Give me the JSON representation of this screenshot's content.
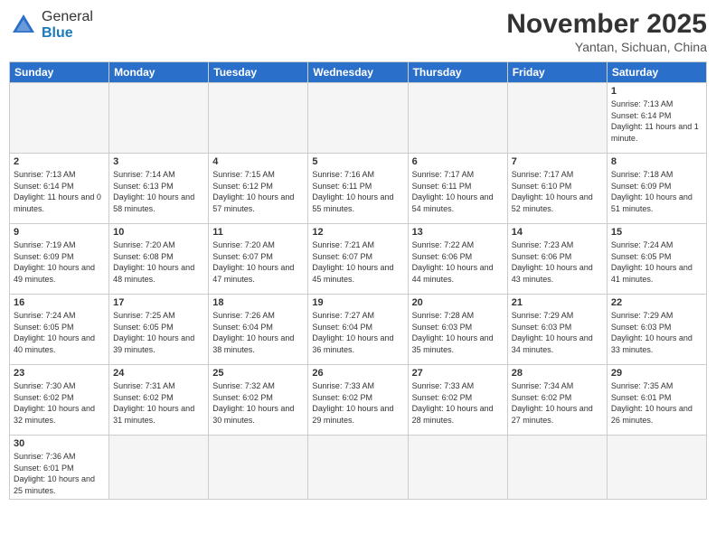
{
  "header": {
    "logo_general": "General",
    "logo_blue": "Blue",
    "month_title": "November 2025",
    "location": "Yantan, Sichuan, China"
  },
  "days_of_week": [
    "Sunday",
    "Monday",
    "Tuesday",
    "Wednesday",
    "Thursday",
    "Friday",
    "Saturday"
  ],
  "weeks": [
    [
      {
        "day": "",
        "empty": true
      },
      {
        "day": "",
        "empty": true
      },
      {
        "day": "",
        "empty": true
      },
      {
        "day": "",
        "empty": true
      },
      {
        "day": "",
        "empty": true
      },
      {
        "day": "",
        "empty": true
      },
      {
        "day": "1",
        "sunrise": "Sunrise: 7:13 AM",
        "sunset": "Sunset: 6:14 PM",
        "daylight": "Daylight: 11 hours and 1 minute."
      }
    ],
    [
      {
        "day": "2",
        "sunrise": "Sunrise: 7:13 AM",
        "sunset": "Sunset: 6:14 PM",
        "daylight": "Daylight: 11 hours and 0 minutes."
      },
      {
        "day": "3",
        "sunrise": "Sunrise: 7:14 AM",
        "sunset": "Sunset: 6:13 PM",
        "daylight": "Daylight: 10 hours and 58 minutes."
      },
      {
        "day": "4",
        "sunrise": "Sunrise: 7:15 AM",
        "sunset": "Sunset: 6:12 PM",
        "daylight": "Daylight: 10 hours and 57 minutes."
      },
      {
        "day": "5",
        "sunrise": "Sunrise: 7:16 AM",
        "sunset": "Sunset: 6:11 PM",
        "daylight": "Daylight: 10 hours and 55 minutes."
      },
      {
        "day": "6",
        "sunrise": "Sunrise: 7:17 AM",
        "sunset": "Sunset: 6:11 PM",
        "daylight": "Daylight: 10 hours and 54 minutes."
      },
      {
        "day": "7",
        "sunrise": "Sunrise: 7:17 AM",
        "sunset": "Sunset: 6:10 PM",
        "daylight": "Daylight: 10 hours and 52 minutes."
      },
      {
        "day": "8",
        "sunrise": "Sunrise: 7:18 AM",
        "sunset": "Sunset: 6:09 PM",
        "daylight": "Daylight: 10 hours and 51 minutes."
      }
    ],
    [
      {
        "day": "9",
        "sunrise": "Sunrise: 7:19 AM",
        "sunset": "Sunset: 6:09 PM",
        "daylight": "Daylight: 10 hours and 49 minutes."
      },
      {
        "day": "10",
        "sunrise": "Sunrise: 7:20 AM",
        "sunset": "Sunset: 6:08 PM",
        "daylight": "Daylight: 10 hours and 48 minutes."
      },
      {
        "day": "11",
        "sunrise": "Sunrise: 7:20 AM",
        "sunset": "Sunset: 6:07 PM",
        "daylight": "Daylight: 10 hours and 47 minutes."
      },
      {
        "day": "12",
        "sunrise": "Sunrise: 7:21 AM",
        "sunset": "Sunset: 6:07 PM",
        "daylight": "Daylight: 10 hours and 45 minutes."
      },
      {
        "day": "13",
        "sunrise": "Sunrise: 7:22 AM",
        "sunset": "Sunset: 6:06 PM",
        "daylight": "Daylight: 10 hours and 44 minutes."
      },
      {
        "day": "14",
        "sunrise": "Sunrise: 7:23 AM",
        "sunset": "Sunset: 6:06 PM",
        "daylight": "Daylight: 10 hours and 43 minutes."
      },
      {
        "day": "15",
        "sunrise": "Sunrise: 7:24 AM",
        "sunset": "Sunset: 6:05 PM",
        "daylight": "Daylight: 10 hours and 41 minutes."
      }
    ],
    [
      {
        "day": "16",
        "sunrise": "Sunrise: 7:24 AM",
        "sunset": "Sunset: 6:05 PM",
        "daylight": "Daylight: 10 hours and 40 minutes."
      },
      {
        "day": "17",
        "sunrise": "Sunrise: 7:25 AM",
        "sunset": "Sunset: 6:05 PM",
        "daylight": "Daylight: 10 hours and 39 minutes."
      },
      {
        "day": "18",
        "sunrise": "Sunrise: 7:26 AM",
        "sunset": "Sunset: 6:04 PM",
        "daylight": "Daylight: 10 hours and 38 minutes."
      },
      {
        "day": "19",
        "sunrise": "Sunrise: 7:27 AM",
        "sunset": "Sunset: 6:04 PM",
        "daylight": "Daylight: 10 hours and 36 minutes."
      },
      {
        "day": "20",
        "sunrise": "Sunrise: 7:28 AM",
        "sunset": "Sunset: 6:03 PM",
        "daylight": "Daylight: 10 hours and 35 minutes."
      },
      {
        "day": "21",
        "sunrise": "Sunrise: 7:29 AM",
        "sunset": "Sunset: 6:03 PM",
        "daylight": "Daylight: 10 hours and 34 minutes."
      },
      {
        "day": "22",
        "sunrise": "Sunrise: 7:29 AM",
        "sunset": "Sunset: 6:03 PM",
        "daylight": "Daylight: 10 hours and 33 minutes."
      }
    ],
    [
      {
        "day": "23",
        "sunrise": "Sunrise: 7:30 AM",
        "sunset": "Sunset: 6:02 PM",
        "daylight": "Daylight: 10 hours and 32 minutes."
      },
      {
        "day": "24",
        "sunrise": "Sunrise: 7:31 AM",
        "sunset": "Sunset: 6:02 PM",
        "daylight": "Daylight: 10 hours and 31 minutes."
      },
      {
        "day": "25",
        "sunrise": "Sunrise: 7:32 AM",
        "sunset": "Sunset: 6:02 PM",
        "daylight": "Daylight: 10 hours and 30 minutes."
      },
      {
        "day": "26",
        "sunrise": "Sunrise: 7:33 AM",
        "sunset": "Sunset: 6:02 PM",
        "daylight": "Daylight: 10 hours and 29 minutes."
      },
      {
        "day": "27",
        "sunrise": "Sunrise: 7:33 AM",
        "sunset": "Sunset: 6:02 PM",
        "daylight": "Daylight: 10 hours and 28 minutes."
      },
      {
        "day": "28",
        "sunrise": "Sunrise: 7:34 AM",
        "sunset": "Sunset: 6:02 PM",
        "daylight": "Daylight: 10 hours and 27 minutes."
      },
      {
        "day": "29",
        "sunrise": "Sunrise: 7:35 AM",
        "sunset": "Sunset: 6:01 PM",
        "daylight": "Daylight: 10 hours and 26 minutes."
      }
    ],
    [
      {
        "day": "30",
        "sunrise": "Sunrise: 7:36 AM",
        "sunset": "Sunset: 6:01 PM",
        "daylight": "Daylight: 10 hours and 25 minutes."
      },
      {
        "day": "",
        "empty": true
      },
      {
        "day": "",
        "empty": true
      },
      {
        "day": "",
        "empty": true
      },
      {
        "day": "",
        "empty": true
      },
      {
        "day": "",
        "empty": true
      },
      {
        "day": "",
        "empty": true
      }
    ]
  ]
}
